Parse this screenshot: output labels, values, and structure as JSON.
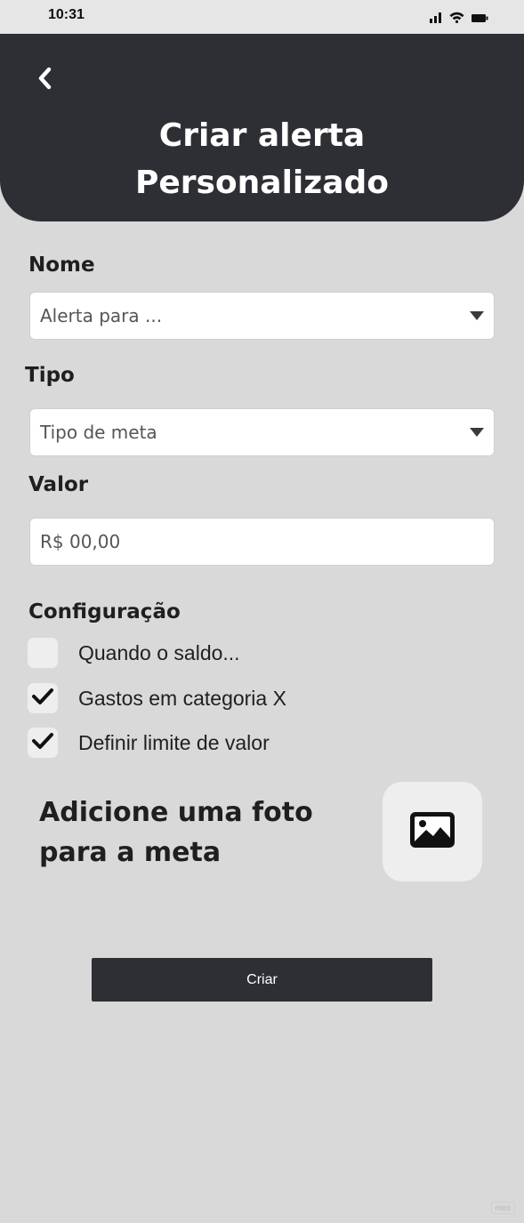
{
  "status_bar": {
    "time": "10:31",
    "icons": [
      "signal-icon",
      "wifi-icon",
      "battery-icon"
    ]
  },
  "header": {
    "back_icon": "chevron-left-icon",
    "title_line1": "Criar alerta",
    "title_line2": "Personalizado",
    "background": "#2e2f35"
  },
  "form": {
    "name": {
      "label": "Nome",
      "placeholder": "Alerta para ..."
    },
    "type": {
      "label": "Tipo",
      "placeholder": "Tipo de meta"
    },
    "value": {
      "label": "Valor",
      "placeholder": "R$ 00,00"
    },
    "config": {
      "label": "Configuração",
      "options": [
        {
          "label": "Quando o saldo...",
          "checked": false
        },
        {
          "label": "Gastos em categoria X",
          "checked": true
        },
        {
          "label": "Definir limite de valor",
          "checked": true
        }
      ]
    }
  },
  "photo": {
    "text_line1": "Adicione uma foto",
    "text_line2": "para a meta",
    "icon": "image-icon"
  },
  "actions": {
    "create_label": "Criar"
  },
  "watermark": "miro"
}
